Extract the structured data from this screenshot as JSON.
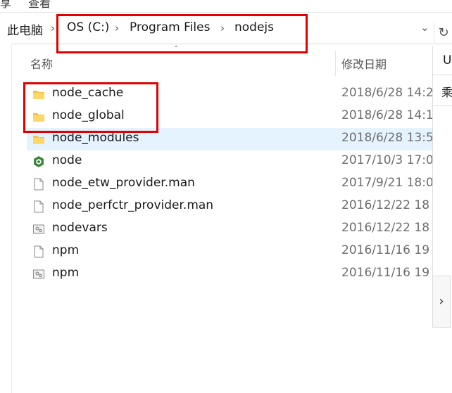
{
  "address_bar": {
    "crumbs": [
      "此电脑",
      "OS (C:)",
      "Program Files",
      "nodejs"
    ],
    "dropdown_icon": "chevron-down-icon",
    "refresh_icon": "refresh-icon"
  },
  "columns": {
    "name": "名称",
    "date": "修改日期"
  },
  "files": [
    {
      "name": "node_cache",
      "date": "2018/6/28 14:2",
      "icon": "folder-icon",
      "selected": false
    },
    {
      "name": "node_global",
      "date": "2018/6/28 14:1",
      "icon": "folder-icon",
      "selected": false
    },
    {
      "name": "node_modules",
      "date": "2018/6/28 13:5",
      "icon": "folder-icon",
      "selected": true
    },
    {
      "name": "node",
      "date": "2017/10/3 17:0",
      "icon": "nodejs-app-icon",
      "selected": false
    },
    {
      "name": "node_etw_provider.man",
      "date": "2017/9/21 18:0",
      "icon": "file-icon",
      "selected": false
    },
    {
      "name": "node_perfctr_provider.man",
      "date": "2016/12/22 18",
      "icon": "file-icon",
      "selected": false
    },
    {
      "name": "nodevars",
      "date": "2016/12/22 18",
      "icon": "settings-file-icon",
      "selected": false
    },
    {
      "name": "npm",
      "date": "2016/11/16 19",
      "icon": "file-icon",
      "selected": false
    },
    {
      "name": "npm",
      "date": "2016/11/16 19",
      "icon": "settings-file-icon",
      "selected": false
    }
  ],
  "right_pane": {
    "header_text": "U",
    "cell_text": "乘"
  },
  "colors": {
    "highlight_red": "#e00000",
    "selection_bg": "#e5f3ff",
    "folder": "#f5c342",
    "node_green": "#3c873a"
  }
}
